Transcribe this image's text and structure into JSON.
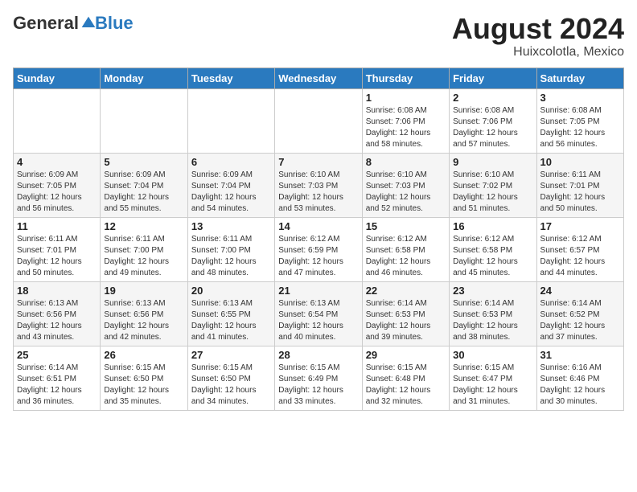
{
  "header": {
    "logo": {
      "general": "General",
      "blue": "Blue",
      "tagline": ""
    },
    "title": "August 2024",
    "location": "Huixcolotla, Mexico"
  },
  "weekdays": [
    "Sunday",
    "Monday",
    "Tuesday",
    "Wednesday",
    "Thursday",
    "Friday",
    "Saturday"
  ],
  "weeks": [
    [
      {
        "day": "",
        "info": ""
      },
      {
        "day": "",
        "info": ""
      },
      {
        "day": "",
        "info": ""
      },
      {
        "day": "",
        "info": ""
      },
      {
        "day": "1",
        "info": "Sunrise: 6:08 AM\nSunset: 7:06 PM\nDaylight: 12 hours\nand 58 minutes."
      },
      {
        "day": "2",
        "info": "Sunrise: 6:08 AM\nSunset: 7:06 PM\nDaylight: 12 hours\nand 57 minutes."
      },
      {
        "day": "3",
        "info": "Sunrise: 6:08 AM\nSunset: 7:05 PM\nDaylight: 12 hours\nand 56 minutes."
      }
    ],
    [
      {
        "day": "4",
        "info": "Sunrise: 6:09 AM\nSunset: 7:05 PM\nDaylight: 12 hours\nand 56 minutes."
      },
      {
        "day": "5",
        "info": "Sunrise: 6:09 AM\nSunset: 7:04 PM\nDaylight: 12 hours\nand 55 minutes."
      },
      {
        "day": "6",
        "info": "Sunrise: 6:09 AM\nSunset: 7:04 PM\nDaylight: 12 hours\nand 54 minutes."
      },
      {
        "day": "7",
        "info": "Sunrise: 6:10 AM\nSunset: 7:03 PM\nDaylight: 12 hours\nand 53 minutes."
      },
      {
        "day": "8",
        "info": "Sunrise: 6:10 AM\nSunset: 7:03 PM\nDaylight: 12 hours\nand 52 minutes."
      },
      {
        "day": "9",
        "info": "Sunrise: 6:10 AM\nSunset: 7:02 PM\nDaylight: 12 hours\nand 51 minutes."
      },
      {
        "day": "10",
        "info": "Sunrise: 6:11 AM\nSunset: 7:01 PM\nDaylight: 12 hours\nand 50 minutes."
      }
    ],
    [
      {
        "day": "11",
        "info": "Sunrise: 6:11 AM\nSunset: 7:01 PM\nDaylight: 12 hours\nand 50 minutes."
      },
      {
        "day": "12",
        "info": "Sunrise: 6:11 AM\nSunset: 7:00 PM\nDaylight: 12 hours\nand 49 minutes."
      },
      {
        "day": "13",
        "info": "Sunrise: 6:11 AM\nSunset: 7:00 PM\nDaylight: 12 hours\nand 48 minutes."
      },
      {
        "day": "14",
        "info": "Sunrise: 6:12 AM\nSunset: 6:59 PM\nDaylight: 12 hours\nand 47 minutes."
      },
      {
        "day": "15",
        "info": "Sunrise: 6:12 AM\nSunset: 6:58 PM\nDaylight: 12 hours\nand 46 minutes."
      },
      {
        "day": "16",
        "info": "Sunrise: 6:12 AM\nSunset: 6:58 PM\nDaylight: 12 hours\nand 45 minutes."
      },
      {
        "day": "17",
        "info": "Sunrise: 6:12 AM\nSunset: 6:57 PM\nDaylight: 12 hours\nand 44 minutes."
      }
    ],
    [
      {
        "day": "18",
        "info": "Sunrise: 6:13 AM\nSunset: 6:56 PM\nDaylight: 12 hours\nand 43 minutes."
      },
      {
        "day": "19",
        "info": "Sunrise: 6:13 AM\nSunset: 6:56 PM\nDaylight: 12 hours\nand 42 minutes."
      },
      {
        "day": "20",
        "info": "Sunrise: 6:13 AM\nSunset: 6:55 PM\nDaylight: 12 hours\nand 41 minutes."
      },
      {
        "day": "21",
        "info": "Sunrise: 6:13 AM\nSunset: 6:54 PM\nDaylight: 12 hours\nand 40 minutes."
      },
      {
        "day": "22",
        "info": "Sunrise: 6:14 AM\nSunset: 6:53 PM\nDaylight: 12 hours\nand 39 minutes."
      },
      {
        "day": "23",
        "info": "Sunrise: 6:14 AM\nSunset: 6:53 PM\nDaylight: 12 hours\nand 38 minutes."
      },
      {
        "day": "24",
        "info": "Sunrise: 6:14 AM\nSunset: 6:52 PM\nDaylight: 12 hours\nand 37 minutes."
      }
    ],
    [
      {
        "day": "25",
        "info": "Sunrise: 6:14 AM\nSunset: 6:51 PM\nDaylight: 12 hours\nand 36 minutes."
      },
      {
        "day": "26",
        "info": "Sunrise: 6:15 AM\nSunset: 6:50 PM\nDaylight: 12 hours\nand 35 minutes."
      },
      {
        "day": "27",
        "info": "Sunrise: 6:15 AM\nSunset: 6:50 PM\nDaylight: 12 hours\nand 34 minutes."
      },
      {
        "day": "28",
        "info": "Sunrise: 6:15 AM\nSunset: 6:49 PM\nDaylight: 12 hours\nand 33 minutes."
      },
      {
        "day": "29",
        "info": "Sunrise: 6:15 AM\nSunset: 6:48 PM\nDaylight: 12 hours\nand 32 minutes."
      },
      {
        "day": "30",
        "info": "Sunrise: 6:15 AM\nSunset: 6:47 PM\nDaylight: 12 hours\nand 31 minutes."
      },
      {
        "day": "31",
        "info": "Sunrise: 6:16 AM\nSunset: 6:46 PM\nDaylight: 12 hours\nand 30 minutes."
      }
    ]
  ]
}
